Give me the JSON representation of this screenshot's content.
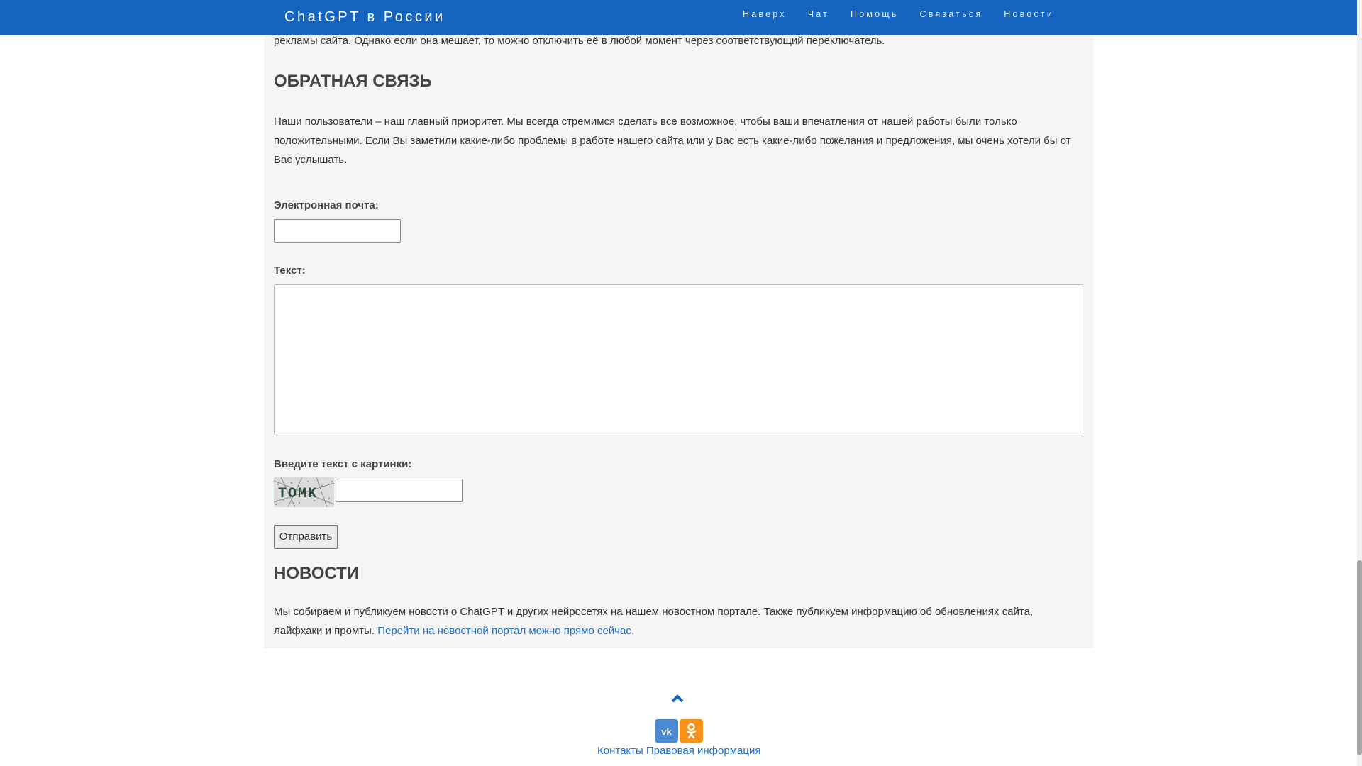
{
  "header": {
    "brand": "ChatGPT в России",
    "nav": [
      "Наверх",
      "Чат",
      "Помощь",
      "Связаться",
      "Новости"
    ]
  },
  "intro": {
    "text": "рекламы сайта. Однако если она мешает, то можно отключить её в любой момент через соответствующий переключатель."
  },
  "feedback": {
    "heading": "ОБРАТНАЯ СВЯЗЬ",
    "text": "Наши пользователи – наш главный приоритет. Мы всегда стремимся сделать все возможное, чтобы ваши впечатления от нашей работы были только положительными. Если Вы заметили какие-либо проблемы в работе нашего сайта или у Вас есть какие-либо пожелания и предложения, мы очень хотели бы от Вас услышать.",
    "email_label": "Электронная почта:",
    "email_value": "",
    "text_label": "Текст:",
    "text_value": "",
    "captcha_label": "Введите текст с картинки:",
    "captcha_image_text": "TOMK",
    "captcha_value": "",
    "submit_label": "Отправить"
  },
  "news": {
    "heading": "НОВОСТИ",
    "text": "Мы собираем и публикуем новости о ChatGPT и других нейросетях на нашем новостном портале. Также публикуем информацию об обновлениях сайта, лайфхаки и промты. ",
    "link": "Перейти на новостной портал можно прямо сейчас."
  },
  "footer": {
    "contacts": "Контакты",
    "legal": "Правовая информация",
    "social": [
      "vk-icon",
      "odnoklassniki-icon"
    ]
  },
  "colors": {
    "nav_bg": "#1565c0",
    "link": "#1e6fc8",
    "vk": "#4a8ad3",
    "ok": "#f59218"
  }
}
